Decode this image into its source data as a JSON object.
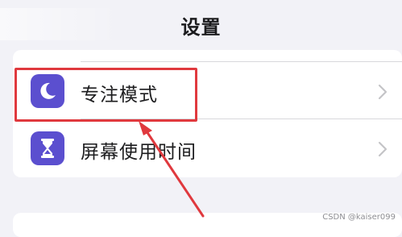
{
  "nav": {
    "title": "设置"
  },
  "settings": {
    "items": [
      {
        "label": "专注模式",
        "icon": "moon-icon"
      },
      {
        "label": "屏幕使用时间",
        "icon": "hourglass-icon"
      }
    ]
  },
  "annotation": {
    "highlight_color": "#e0393e"
  },
  "watermark": {
    "text": "CSDN @kaiser099"
  },
  "colors": {
    "accent_icon": "#5b4fcf",
    "background": "#f2f2f7",
    "chevron": "#c4c4c7"
  }
}
